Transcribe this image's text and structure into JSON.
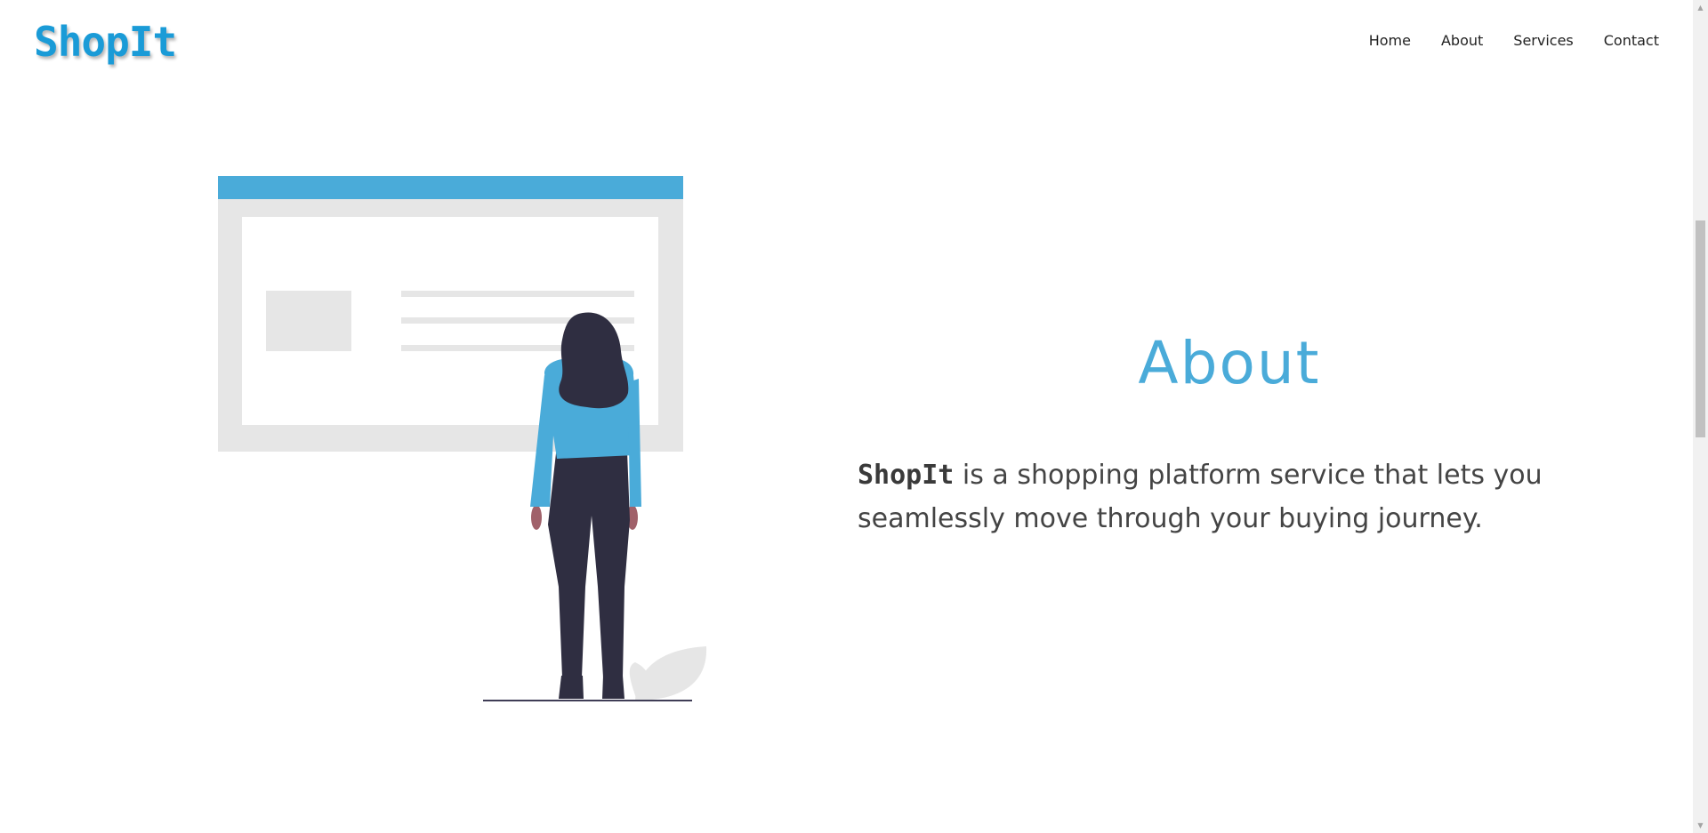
{
  "brand": {
    "logo_text": "ShopIt",
    "color": "#1a9bd7"
  },
  "nav": {
    "items": [
      {
        "label": "Home"
      },
      {
        "label": "About"
      },
      {
        "label": "Services"
      },
      {
        "label": "Contact"
      }
    ]
  },
  "about": {
    "title": "About",
    "brand_name": "ShopIt",
    "description": " is a shopping platform service that lets you seamlessly move through your buying journey.",
    "title_color": "#4aabd9"
  },
  "illustration": {
    "icon": "woman-viewing-browser-window-illustration",
    "accent_color": "#4aabd9",
    "figure_color": "#2f2e41"
  },
  "scrollbar": {
    "up_icon": "▲",
    "down_icon": "▼"
  }
}
